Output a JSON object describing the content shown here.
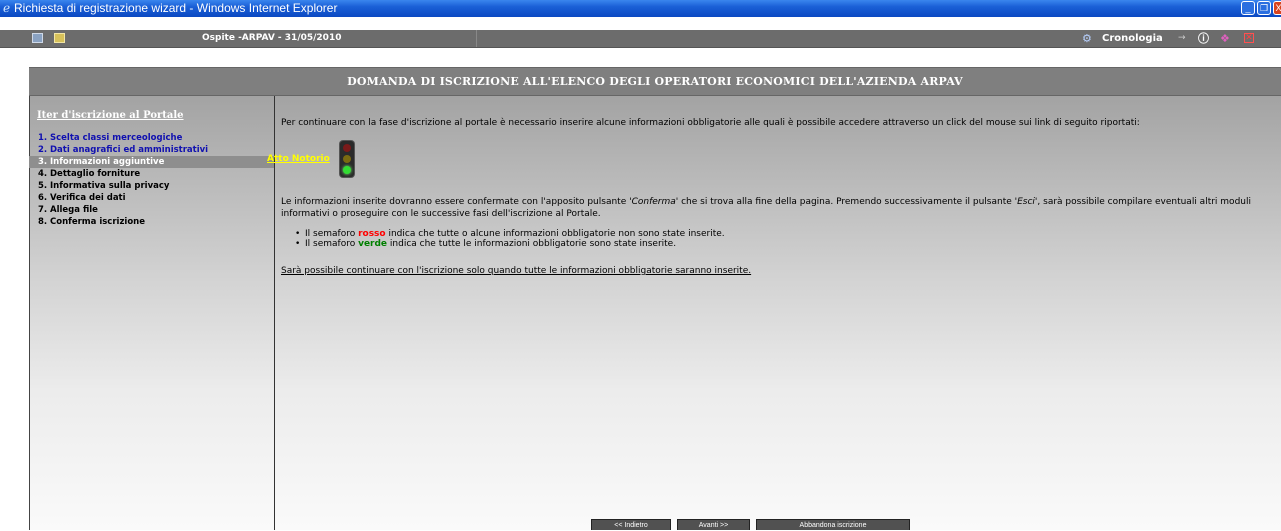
{
  "window": {
    "title": "Richiesta di registrazione wizard - Windows Internet Explorer",
    "minimize": "_",
    "maximize": "❐",
    "close": "X"
  },
  "topbar": {
    "ospite": "Ospite -ARPAV - 31/05/2010",
    "cronologia": "Cronologia"
  },
  "page": {
    "header_title": "DOMANDA DI ISCRIZIONE ALL'ELENCO DEGLI OPERATORI ECONOMICI DELL'AZIENDA ARPAV"
  },
  "sidebar": {
    "title": "Iter d'iscrizione al Portale",
    "steps": [
      {
        "num": "1.",
        "label": "Scelta classi merceologiche",
        "state": "done"
      },
      {
        "num": "2.",
        "label": "Dati anagrafici ed amministrativi",
        "state": "done"
      },
      {
        "num": "3.",
        "label": "Informazioni aggiuntive",
        "state": "active"
      },
      {
        "num": "4.",
        "label": "Dettaglio forniture",
        "state": "todo"
      },
      {
        "num": "5.",
        "label": "Informativa sulla privacy",
        "state": "todo"
      },
      {
        "num": "6.",
        "label": "Verifica dei dati",
        "state": "todo"
      },
      {
        "num": "7.",
        "label": "Allega file",
        "state": "todo"
      },
      {
        "num": "8.",
        "label": "Conferma iscrizione",
        "state": "todo"
      }
    ]
  },
  "content": {
    "intro": "Per continuare con la fase d'iscrizione al portale è necessario inserire alcune informazioni obbligatorie alle quali è possibile accedere attraverso un click del mouse sui link di seguito riportati:",
    "atto_link": "Atto Notorio",
    "para1_a": "Le informazioni inserite dovranno essere confermate con l'apposito pulsante ",
    "para1_conferma": "'Conferma'",
    "para1_b": " che si trova alla fine della pagina. Premendo successivamente il pulsante ",
    "para1_esci": "'Esci'",
    "para1_c": ", sarà possibile compilare eventuali altri moduli informativi o proseguire con le successive fasi dell'iscrizione al Portale.",
    "bullet1_a": "Il semaforo ",
    "bullet1_color": "rosso",
    "bullet1_b": " indica che tutte o alcune informazioni obbligatorie non sono state inserite.",
    "bullet2_a": "Il semaforo ",
    "bullet2_color": "verde",
    "bullet2_b": " indica che tutte le informazioni obbligatorie sono state inserite.",
    "final": "Sarà possibile continuare con l'iscrizione solo quando tutte le informazioni obbligatorie saranno inserite."
  },
  "buttons": {
    "back": "<< Indietro",
    "next": "Avanti >>",
    "abort": "Abbandona iscrizione"
  },
  "colors": {
    "titlebar": "#0b49c2",
    "header_band": "#7f7f7f",
    "active_step_bg": "#8e8e8e",
    "link_yellow": "#ffff00",
    "rosso": "#ff0000",
    "verde": "#008000"
  },
  "traffic_light": {
    "state": "green"
  }
}
